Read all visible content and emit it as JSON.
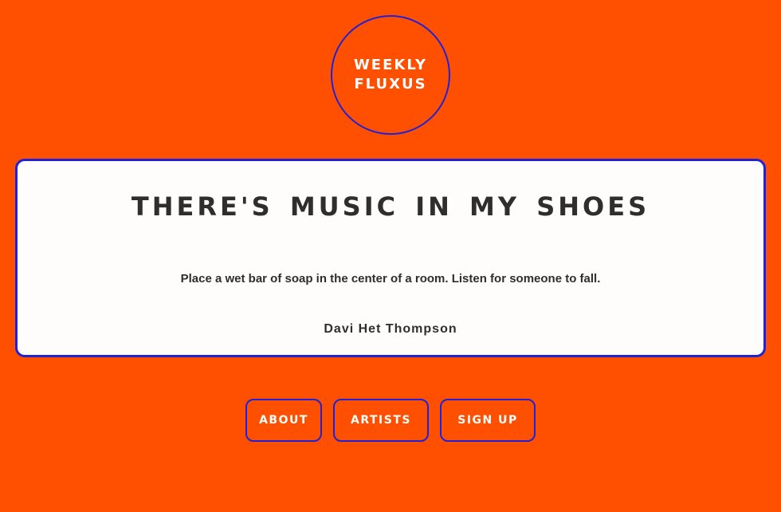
{
  "logo": {
    "line1": "WEEKLY",
    "line2": "FLUXUS"
  },
  "piece": {
    "title": "THERE'S MUSIC IN MY SHOES",
    "instruction": "Place a wet bar of soap in the center of a room. Listen for someone to fall.",
    "artist": "Davi Het Thompson"
  },
  "nav": {
    "about": "ABOUT",
    "artists": "ARTISTS",
    "signup": "SIGN UP"
  },
  "colors": {
    "background": "#ff4f00",
    "accent_border": "#1f22d6",
    "card_background": "#fffdfb",
    "text_dark": "#2e2e2e",
    "text_light": "#ffffff"
  }
}
